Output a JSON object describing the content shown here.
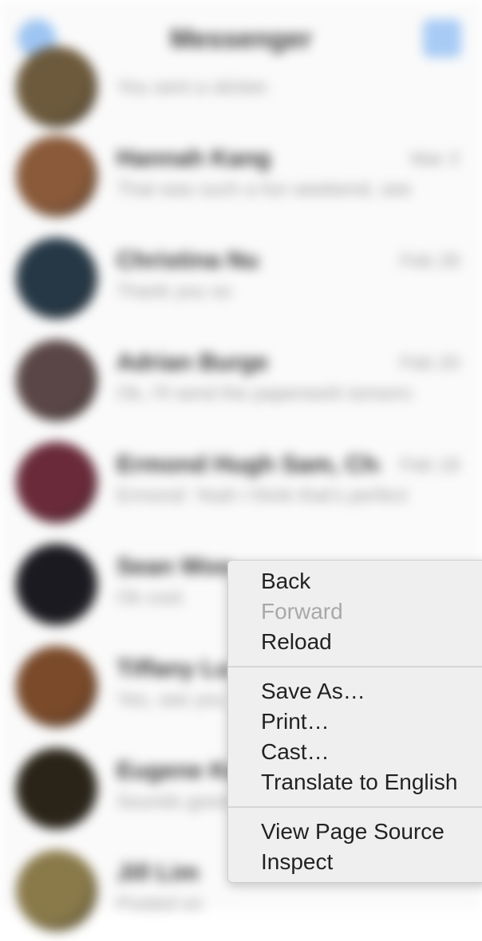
{
  "messenger": {
    "title": "Messenger",
    "conversations": [
      {
        "name": "",
        "time": "",
        "snippet": "You sent a sticker.",
        "avatar_color": "#6d5a3c"
      },
      {
        "name": "Hannah Kang",
        "time": "Mar 2",
        "snippet": "That was such a fun weekend, see you soon",
        "avatar_color": "#8a5a3a"
      },
      {
        "name": "Christina Nu",
        "time": "Feb 28",
        "snippet": "Thank you so",
        "avatar_color": "#263846"
      },
      {
        "name": "Adrian Burge",
        "time": "Feb 20",
        "snippet": "Ok, I'll send the paperwork tomorrow",
        "avatar_color": "#5a4646"
      },
      {
        "name": "Ermond Hugh Sam, Cha",
        "time": "Feb 18",
        "snippet": "Ermond: Yeah I think that's perfect",
        "avatar_color": "#6a2a3a"
      },
      {
        "name": "Sean Woo",
        "time": "",
        "snippet": "Ok cool.",
        "avatar_color": "#1a1a20"
      },
      {
        "name": "Tiffany Lu",
        "time": "",
        "snippet": "Yes, see you",
        "avatar_color": "#7a4a2a"
      },
      {
        "name": "Eugene Ko",
        "time": "",
        "snippet": "Sounds good",
        "avatar_color": "#2a2418"
      },
      {
        "name": "Jill Lim",
        "time": "",
        "snippet": "Posted on",
        "avatar_color": "#8a7a4a"
      }
    ]
  },
  "context_menu": {
    "groups": [
      [
        {
          "label": "Back",
          "enabled": true
        },
        {
          "label": "Forward",
          "enabled": false
        },
        {
          "label": "Reload",
          "enabled": true
        }
      ],
      [
        {
          "label": "Save As…",
          "enabled": true
        },
        {
          "label": "Print…",
          "enabled": true
        },
        {
          "label": "Cast…",
          "enabled": true
        },
        {
          "label": "Translate to English",
          "enabled": true
        }
      ],
      [
        {
          "label": "View Page Source",
          "enabled": true
        },
        {
          "label": "Inspect",
          "enabled": true
        }
      ]
    ]
  }
}
